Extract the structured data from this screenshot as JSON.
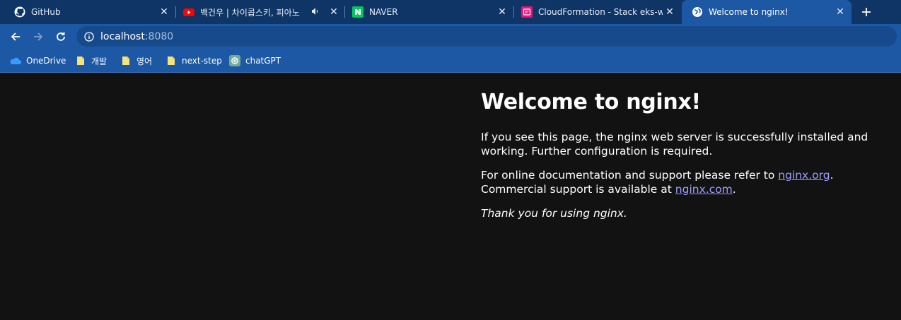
{
  "tabs": [
    {
      "title": "GitHub",
      "icon": "github-icon"
    },
    {
      "title": "백건우 | 차이콥스키, 피아노",
      "icon": "youtube-icon",
      "audio": true
    },
    {
      "title": "NAVER",
      "icon": "naver-icon"
    },
    {
      "title": "CloudFormation - Stack eks-wor",
      "icon": "cloudformation-icon"
    },
    {
      "title": "Welcome to nginx!",
      "icon": "globe-icon",
      "active": true
    }
  ],
  "toolbar": {
    "url_host": "localhost",
    "url_port": ":8080"
  },
  "bookmarks": [
    {
      "label": "OneDrive",
      "icon": "onedrive-icon"
    },
    {
      "label": "개발",
      "icon": "folder-icon"
    },
    {
      "label": "영어",
      "icon": "folder-icon"
    },
    {
      "label": "next-step",
      "icon": "folder-icon"
    },
    {
      "label": "chatGPT",
      "icon": "chatgpt-icon"
    }
  ],
  "page": {
    "heading": "Welcome to nginx!",
    "p1": "If you see this page, the nginx web server is successfully installed and working. Further configuration is required.",
    "p2_before": "For online documentation and support please refer to ",
    "link1": "nginx.org",
    "p2_mid": ".",
    "p2_line2": "Commercial support is available at ",
    "link2": "nginx.com",
    "p2_end": ".",
    "p3": "Thank you for using nginx."
  },
  "colors": {
    "tabstrip": "#0e3566",
    "toolbar": "#1d58a5",
    "page_bg": "#121212",
    "link": "#9e9eff"
  }
}
